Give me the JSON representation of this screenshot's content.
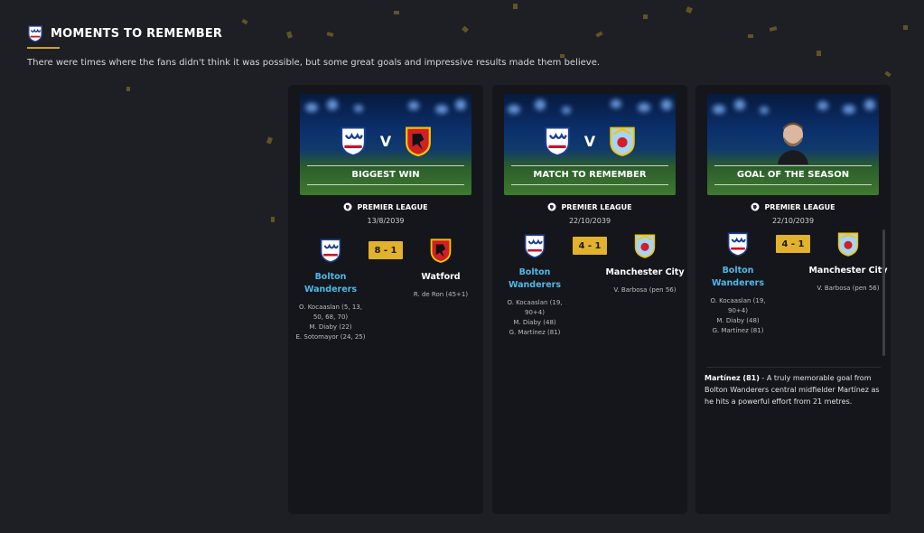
{
  "header": {
    "title": "MOMENTS TO REMEMBER",
    "subtitle": "There were times where the fans didn't think it was possible, but some great goals and impressive results made them believe."
  },
  "colors": {
    "accent": "#c9a227",
    "score_bg": "#e2b12d",
    "home_team": "#4fb8e8"
  },
  "cards": [
    {
      "banner_label": "BIGGEST WIN",
      "league": "PREMIER LEAGUE",
      "date": "13/8/2039",
      "home": {
        "name": "Bolton Wanderers",
        "scorers": [
          "O. Kocaaslan (5, 13,",
          "50, 68, 70)",
          "M. Diaby (22)",
          "E. Sotomayor (24, 25)"
        ]
      },
      "score": "8 - 1",
      "away": {
        "name": "Watford",
        "scorers": [
          "R. de Ron (45+1)"
        ]
      }
    },
    {
      "banner_label": "MATCH TO REMEMBER",
      "league": "PREMIER LEAGUE",
      "date": "22/10/2039",
      "home": {
        "name": "Bolton Wanderers",
        "scorers": [
          "O. Kocaaslan (19,",
          "90+4)",
          "M. Diaby (48)",
          "G. Martínez (81)"
        ]
      },
      "score": "4 - 1",
      "away": {
        "name": "Manchester City",
        "scorers": [
          "V. Barbosa (pen 56)"
        ]
      }
    },
    {
      "banner_label": "GOAL OF THE SEASON",
      "league": "PREMIER LEAGUE",
      "date": "22/10/2039",
      "home": {
        "name": "Bolton Wanderers",
        "scorers": [
          "O. Kocaaslan (19,",
          "90+4)",
          "M. Diaby (48)",
          "G. Martínez (81)"
        ]
      },
      "score": "4 - 1",
      "away": {
        "name": "Manchester City",
        "scorers": [
          "V. Barbosa (pen 56)"
        ]
      },
      "goal_scorer": "Martínez (81)",
      "goal_description": " - A truly memorable goal from Bolton Wanderers central midfielder Martínez as he hits a powerful effort from 21 metres."
    }
  ]
}
